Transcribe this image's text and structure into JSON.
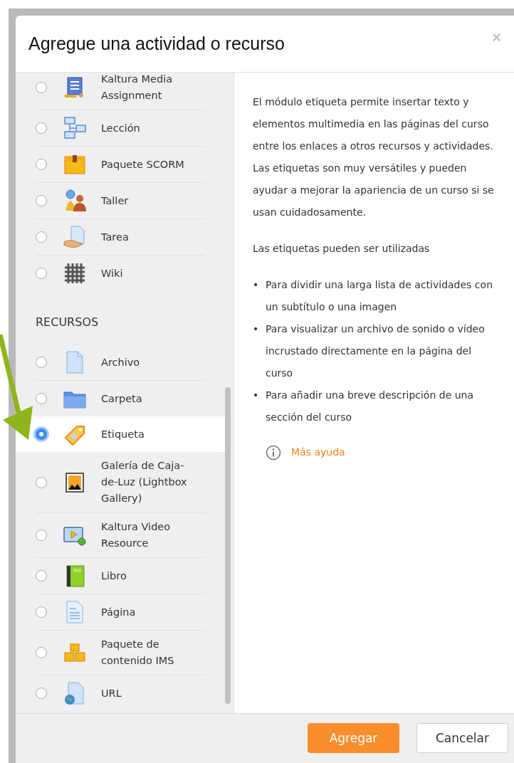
{
  "dialog": {
    "title": "Agregue una actividad o recurso",
    "close": "×"
  },
  "sections": [
    {
      "items": [
        {
          "label": "Kaltura Media Assignment",
          "kind": "assignment",
          "selected": false
        },
        {
          "label": "Lección",
          "kind": "lesson",
          "selected": false
        },
        {
          "label": "Paquete SCORM",
          "kind": "package",
          "selected": false
        },
        {
          "label": "Taller",
          "kind": "workshop",
          "selected": false
        },
        {
          "label": "Tarea",
          "kind": "task",
          "selected": false
        },
        {
          "label": "Wiki",
          "kind": "wiki",
          "selected": false
        }
      ]
    },
    {
      "heading": "RECURSOS",
      "items": [
        {
          "label": "Archivo",
          "kind": "file",
          "selected": false
        },
        {
          "label": "Carpeta",
          "kind": "folder",
          "selected": false
        },
        {
          "label": "Etiqueta",
          "kind": "label",
          "selected": true
        },
        {
          "label": "Galería de Caja-de-Luz (Lightbox Gallery)",
          "kind": "gallery",
          "selected": false
        },
        {
          "label": "Kaltura Video Resource",
          "kind": "video",
          "selected": false
        },
        {
          "label": "Libro",
          "kind": "book",
          "selected": false
        },
        {
          "label": "Página",
          "kind": "page",
          "selected": false
        },
        {
          "label": "Paquete de contenido IMS",
          "kind": "boxes",
          "selected": false
        },
        {
          "label": "URL",
          "kind": "url",
          "selected": false
        }
      ]
    }
  ],
  "description": {
    "paragraphs": [
      "El módulo etiqueta permite insertar texto y elementos multimedia en las páginas del curso entre los enlaces a otros recursos y actividades. Las etiquetas son muy versátiles y pueden ayudar a mejorar la apariencia de un curso si se usan cuidadosamente.",
      "Las etiquetas pueden ser utilizadas"
    ],
    "bullets": [
      {
        "marker": "•",
        "text": "Para dividir una larga lista de actividades con un subtítulo o una imagen"
      },
      {
        "marker": "•",
        "text": "Para visualizar un archivo de sonido o vídeo incrustado directamente en la página del curso"
      },
      {
        "marker": "•",
        "text": "Para añadir una breve descripción de una sección del curso"
      }
    ],
    "more_help": "Más ayuda"
  },
  "buttons": [
    {
      "label": "Agregar",
      "kind": "primary"
    },
    {
      "label": "Cancelar",
      "kind": "secondary"
    }
  ]
}
